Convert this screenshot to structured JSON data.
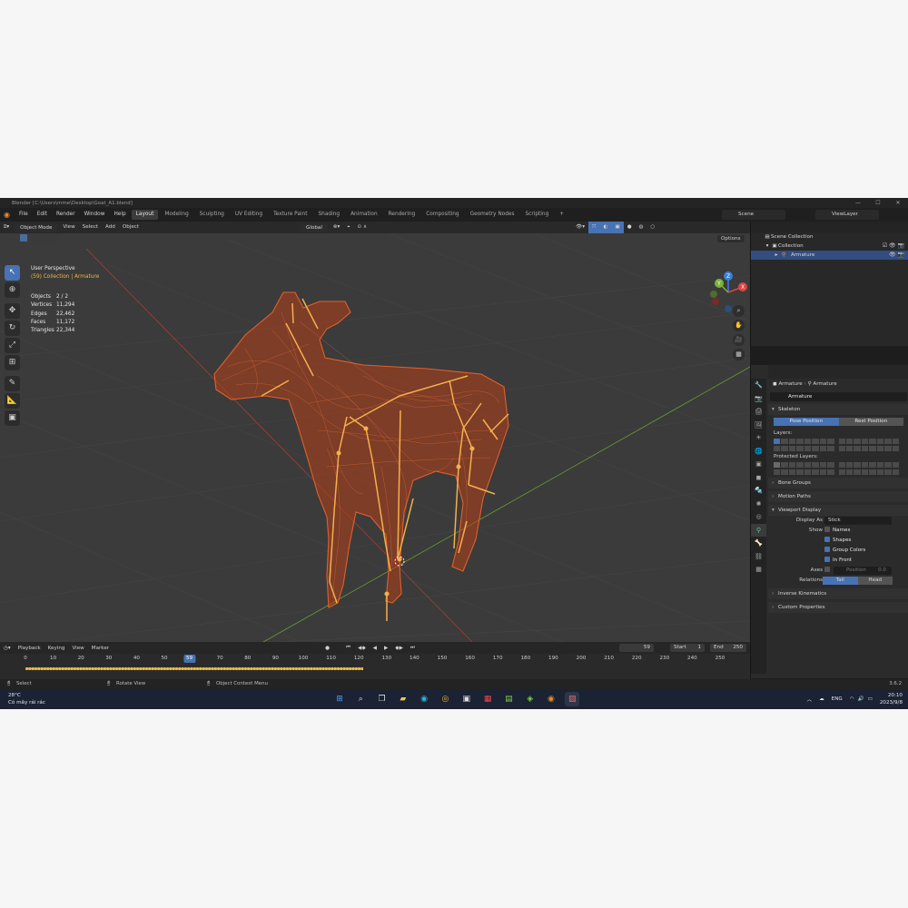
{
  "window": {
    "title": "Blender [C:\\Users\\mme\\Desktop\\Goat_A1.blend]"
  },
  "menu": [
    "File",
    "Edit",
    "Render",
    "Window",
    "Help"
  ],
  "workspaces": [
    "Layout",
    "Modeling",
    "Sculpting",
    "UV Editing",
    "Texture Paint",
    "Shading",
    "Animation",
    "Rendering",
    "Compositing",
    "Geometry Nodes",
    "Scripting"
  ],
  "active_workspace": "Layout",
  "scene": "Scene",
  "view_layer": "ViewLayer",
  "viewport": {
    "mode": "Object Mode",
    "menus": [
      "View",
      "Select",
      "Add",
      "Object"
    ],
    "orientation": "Global",
    "options_label": "Options",
    "perspective": "User Perspective",
    "collection_info": "(59) Collection | Armature",
    "stats": [
      {
        "k": "Objects",
        "v": "2 / 2"
      },
      {
        "k": "Vertices",
        "v": "11,294"
      },
      {
        "k": "Edges",
        "v": "22,462"
      },
      {
        "k": "Faces",
        "v": "11,172"
      },
      {
        "k": "Triangles",
        "v": "22,344"
      }
    ],
    "gizmo": {
      "x": "X",
      "y": "Y",
      "z": "Z"
    }
  },
  "timeline": {
    "menus": [
      "Playback",
      "Keying",
      "View",
      "Marker"
    ],
    "current_frame": "59",
    "start_label": "Start",
    "start": "1",
    "end_label": "End",
    "end": "250",
    "ticks": [
      "0",
      "10",
      "20",
      "30",
      "40",
      "50",
      "59",
      "70",
      "80",
      "90",
      "100",
      "110",
      "120",
      "130",
      "140",
      "150",
      "160",
      "170",
      "180",
      "190",
      "200",
      "210",
      "220",
      "230",
      "240",
      "250"
    ]
  },
  "statusbar": {
    "select": "Select",
    "rotate": "Rotate View",
    "context": "Object Context Menu",
    "version": "3.6.2"
  },
  "outliner": {
    "scene_collection": "Scene Collection",
    "collection": "Collection",
    "armature": "Armature"
  },
  "properties": {
    "crumb_object": "Armature",
    "crumb_data": "Armature",
    "name": "Armature",
    "skeleton": "Skeleton",
    "pose_position": "Pose Position",
    "rest_position": "Rest Position",
    "layers": "Layers:",
    "protected_layers": "Protected Layers:",
    "bone_groups": "Bone Groups",
    "motion_paths": "Motion Paths",
    "viewport_display": "Viewport Display",
    "display_as_label": "Display As",
    "display_as": "Stick",
    "show_label": "Show",
    "names": "Names",
    "shapes": "Shapes",
    "group_colors": "Group Colors",
    "in_front": "In Front",
    "axes_label": "Axes",
    "position_label": "Position",
    "position_value": "0.0",
    "relations_label": "Relations",
    "tail": "Tail",
    "head": "Head",
    "inverse_kinematics": "Inverse Kinematics",
    "custom_properties": "Custom Properties"
  },
  "taskbar": {
    "temp": "28°C",
    "weather": "Có mây rải rác",
    "lang": "ENG",
    "time": "20:10",
    "date": "2023/9/8"
  },
  "colors": {
    "accent": "#4772b3",
    "mesh": "#e0602a",
    "bone": "#f5b04a",
    "selected_text": "#e8b84c"
  }
}
